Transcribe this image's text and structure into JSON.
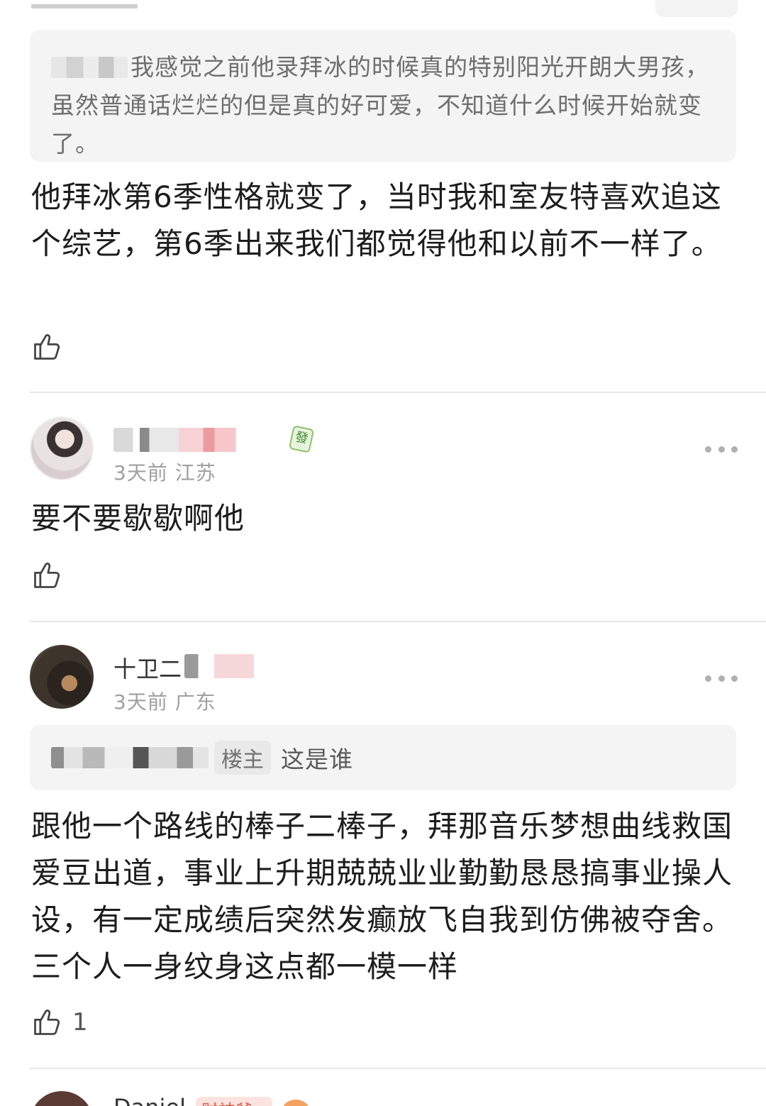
{
  "comments": [
    {
      "quote": {
        "text": "我感觉之前他录拜冰的时候真的特别阳光开朗大男孩，虽然普通话烂烂的但是真的好可爱，不知道什么时候开始就变了。"
      },
      "text": "他拜冰第6季性格就变了，当时我和室友特喜欢追这个综艺，第6季出来我们都觉得他和以前不一样了。",
      "likes": ""
    },
    {
      "user": {
        "meta": "3天前 江苏",
        "badge": "發"
      },
      "text": "要不要歇歇啊他",
      "likes": ""
    },
    {
      "user": {
        "name": "十卫二",
        "meta": "3天前 广东"
      },
      "quote": {
        "op_tag": "楼主",
        "text": "这是谁"
      },
      "text": "跟他一个路线的棒子二棒子，拜那音乐梦想曲线救国爱豆出道，事业上升期兢兢业业勤勤恳恳搞事业操人设，有一定成绩后突然发癫放飞自我到仿佛被夺舍。三个人一身纹身这点都一模一样",
      "likes": "1"
    }
  ],
  "next_user": {
    "name": "Daniel",
    "badge": "财神爷"
  }
}
